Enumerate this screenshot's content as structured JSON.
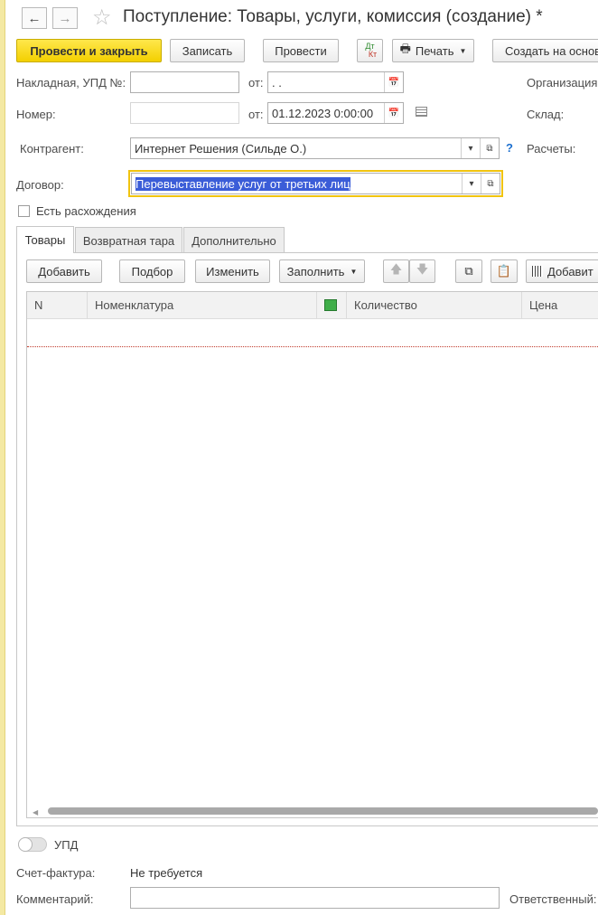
{
  "header": {
    "title": "Поступление: Товары, услуги, комиссия (создание) *"
  },
  "toolbar": {
    "post_close": "Провести и закрыть",
    "save": "Записать",
    "post": "Провести",
    "dtkt_top": "Дт",
    "dtkt_bottom": "Кт",
    "print": "Печать",
    "create_based": "Создать на основ"
  },
  "form": {
    "invoice_label": "Накладная, УПД №:",
    "invoice_number": "",
    "from_label1": "от:",
    "invoice_date": " .  .",
    "number_label": "Номер:",
    "number_value": "",
    "from_label2": "от:",
    "doc_date": "01.12.2023  0:00:00",
    "org_label": "Организация:",
    "warehouse_label": "Склад:",
    "settlements_label": "Расчеты:",
    "counterparty_label": "Контрагент:",
    "counterparty_value": "Интернет Решения (Сильде О.)",
    "help_mark": "?",
    "contract_label": "Договор:",
    "contract_value": "Перевыставление услуг от третьих лиц",
    "discrepancy_label": "Есть расхождения"
  },
  "tabs": [
    "Товары",
    "Возвратная тара",
    "Дополнительно"
  ],
  "grid_toolbar": {
    "add": "Добавить",
    "pick": "Подбор",
    "edit": "Изменить",
    "fill": "Заполнить",
    "add_barcode": "Добавит"
  },
  "table": {
    "columns": [
      "N",
      "Номенклатура",
      "Количество",
      "Цена"
    ]
  },
  "footer": {
    "upd_label": "УПД",
    "upd_enabled": false,
    "invoice_label": "Счет-фактура:",
    "invoice_value": "Не требуется",
    "comment_label": "Комментарий:",
    "comment_value": "",
    "responsible_label": "Ответственный:"
  },
  "colors": {
    "primary_button": "#f3d000",
    "selection": "#3b5dd8",
    "focus_border": "#f1c40f",
    "help": "#1b6fcf"
  }
}
